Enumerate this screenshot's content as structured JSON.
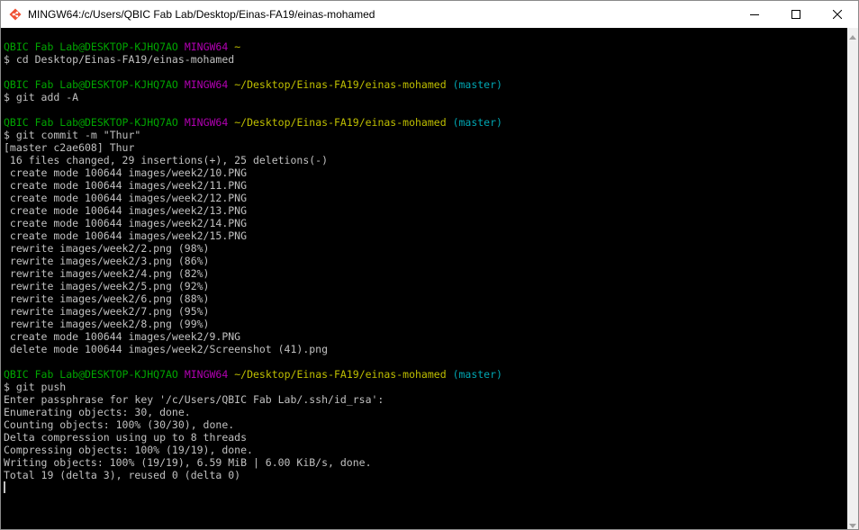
{
  "window": {
    "title": "MINGW64:/c/Users/QBIC Fab Lab/Desktop/Einas-FA19/einas-mohamed",
    "app_icon": "git-bash-icon",
    "controls": [
      "minimize-icon",
      "maximize-icon",
      "close-icon"
    ]
  },
  "colors": {
    "user_host": "#00a600",
    "shell": "#b200b2",
    "path": "#bfbf00",
    "branch": "#00a6b2",
    "text": "#c0c0c0",
    "background": "#000000"
  },
  "terminal": {
    "lines": [
      {
        "type": "prompt",
        "user": "QBIC Fab Lab@DESKTOP-KJHQ7AO",
        "shell": "MINGW64",
        "path": "~",
        "branch": ""
      },
      {
        "type": "text",
        "text": "$ cd Desktop/Einas-FA19/einas-mohamed"
      },
      {
        "type": "blank",
        "text": ""
      },
      {
        "type": "prompt",
        "user": "QBIC Fab Lab@DESKTOP-KJHQ7AO",
        "shell": "MINGW64",
        "path": "~/Desktop/Einas-FA19/einas-mohamed",
        "branch": "(master)"
      },
      {
        "type": "text",
        "text": "$ git add -A"
      },
      {
        "type": "blank",
        "text": ""
      },
      {
        "type": "prompt",
        "user": "QBIC Fab Lab@DESKTOP-KJHQ7AO",
        "shell": "MINGW64",
        "path": "~/Desktop/Einas-FA19/einas-mohamed",
        "branch": "(master)"
      },
      {
        "type": "text",
        "text": "$ git commit -m \"Thur\""
      },
      {
        "type": "text",
        "text": "[master c2ae608] Thur"
      },
      {
        "type": "text",
        "text": " 16 files changed, 29 insertions(+), 25 deletions(-)"
      },
      {
        "type": "text",
        "text": " create mode 100644 images/week2/10.PNG"
      },
      {
        "type": "text",
        "text": " create mode 100644 images/week2/11.PNG"
      },
      {
        "type": "text",
        "text": " create mode 100644 images/week2/12.PNG"
      },
      {
        "type": "text",
        "text": " create mode 100644 images/week2/13.PNG"
      },
      {
        "type": "text",
        "text": " create mode 100644 images/week2/14.PNG"
      },
      {
        "type": "text",
        "text": " create mode 100644 images/week2/15.PNG"
      },
      {
        "type": "text",
        "text": " rewrite images/week2/2.png (98%)"
      },
      {
        "type": "text",
        "text": " rewrite images/week2/3.png (86%)"
      },
      {
        "type": "text",
        "text": " rewrite images/week2/4.png (82%)"
      },
      {
        "type": "text",
        "text": " rewrite images/week2/5.png (92%)"
      },
      {
        "type": "text",
        "text": " rewrite images/week2/6.png (88%)"
      },
      {
        "type": "text",
        "text": " rewrite images/week2/7.png (95%)"
      },
      {
        "type": "text",
        "text": " rewrite images/week2/8.png (99%)"
      },
      {
        "type": "text",
        "text": " create mode 100644 images/week2/9.PNG"
      },
      {
        "type": "text",
        "text": " delete mode 100644 images/week2/Screenshot (41).png"
      },
      {
        "type": "blank",
        "text": ""
      },
      {
        "type": "prompt",
        "user": "QBIC Fab Lab@DESKTOP-KJHQ7AO",
        "shell": "MINGW64",
        "path": "~/Desktop/Einas-FA19/einas-mohamed",
        "branch": "(master)"
      },
      {
        "type": "text",
        "text": "$ git push"
      },
      {
        "type": "text",
        "text": "Enter passphrase for key '/c/Users/QBIC Fab Lab/.ssh/id_rsa':"
      },
      {
        "type": "text",
        "text": "Enumerating objects: 30, done."
      },
      {
        "type": "text",
        "text": "Counting objects: 100% (30/30), done."
      },
      {
        "type": "text",
        "text": "Delta compression using up to 8 threads"
      },
      {
        "type": "text",
        "text": "Compressing objects: 100% (19/19), done."
      },
      {
        "type": "text",
        "text": "Writing objects: 100% (19/19), 6.59 MiB | 6.00 KiB/s, done."
      },
      {
        "type": "text",
        "text": "Total 19 (delta 3), reused 0 (delta 0)"
      },
      {
        "type": "cursor",
        "text": ""
      }
    ]
  }
}
